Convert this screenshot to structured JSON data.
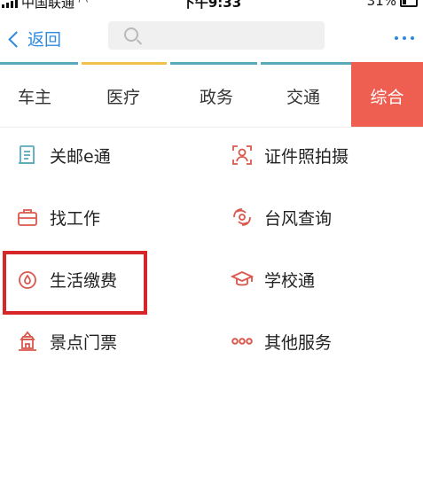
{
  "status_bar": {
    "carrier": "中国联通",
    "time": "下午9:33",
    "battery": "31%"
  },
  "navbar": {
    "back_label": "返回",
    "search_placeholder": ""
  },
  "tabs": [
    {
      "label": "车主"
    },
    {
      "label": "医疗"
    },
    {
      "label": "政务"
    },
    {
      "label": "交通"
    },
    {
      "label": "综合"
    }
  ],
  "services": [
    {
      "label": "关邮e通",
      "icon": "document-icon"
    },
    {
      "label": "证件照拍摄",
      "icon": "id-photo-icon"
    },
    {
      "label": "找工作",
      "icon": "briefcase-icon"
    },
    {
      "label": "台风查询",
      "icon": "typhoon-icon"
    },
    {
      "label": "生活缴费",
      "icon": "utility-payment-icon"
    },
    {
      "label": "学校通",
      "icon": "graduation-cap-icon"
    },
    {
      "label": "景点门票",
      "icon": "temple-icon"
    },
    {
      "label": "其他服务",
      "icon": "more-circles-icon"
    }
  ],
  "colors": {
    "accent_blue": "#2d8adf",
    "active_tab": "#ee5f52",
    "icon_red": "#d9584c",
    "highlight_red": "#d6262a",
    "strip_teal": "#5aa9b8",
    "strip_yellow": "#f0c24b"
  }
}
